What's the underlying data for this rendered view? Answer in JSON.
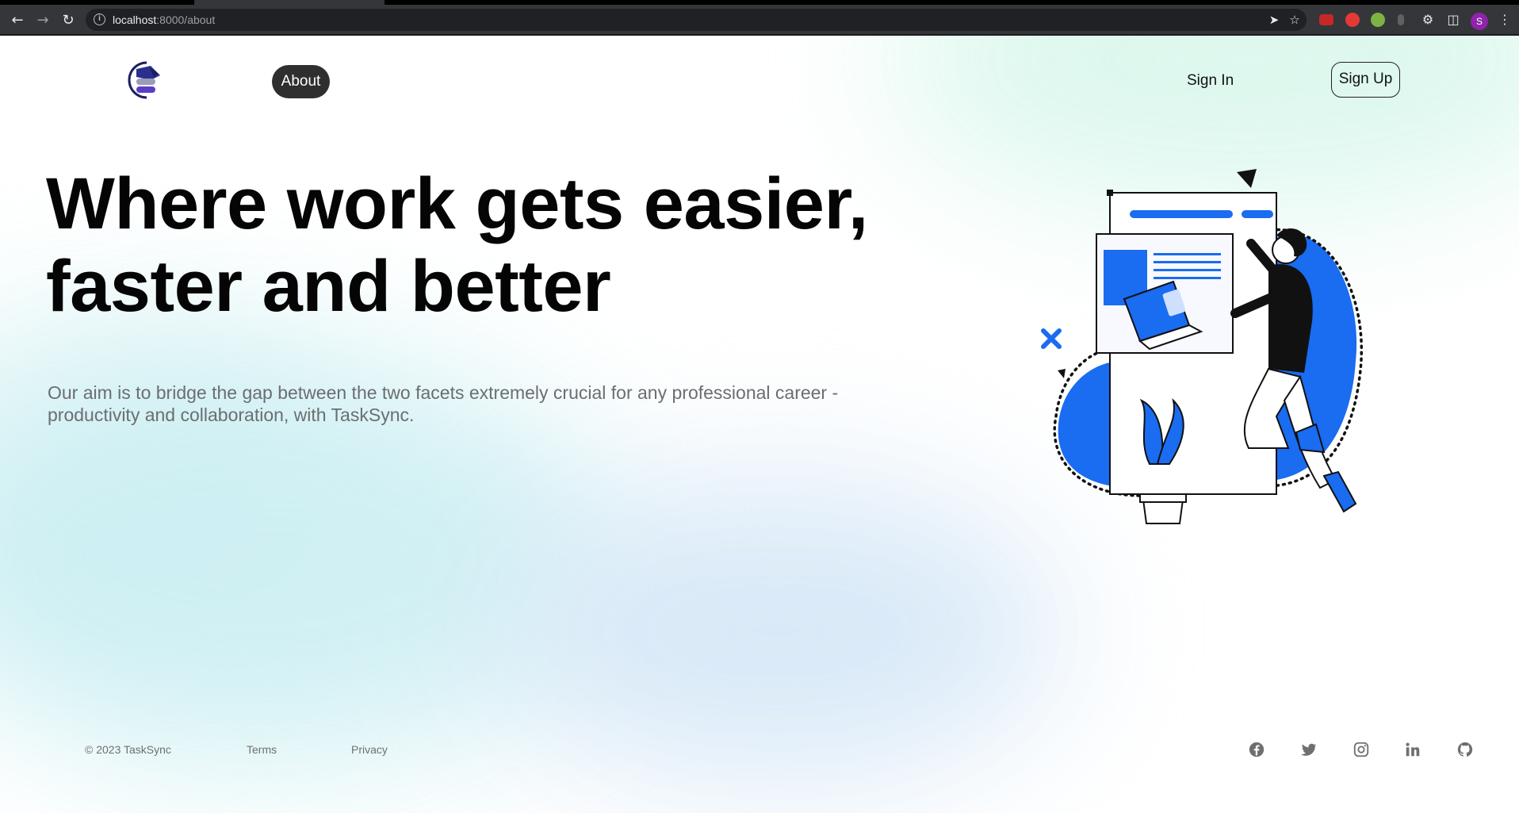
{
  "browser": {
    "url_host": "localhost",
    "url_path": ":8000/about",
    "profile_initial": "S",
    "icons": [
      "back-icon",
      "forward-icon",
      "reload-icon",
      "info-icon",
      "share-icon",
      "star-icon",
      "extensions-icon",
      "sidepanel-icon",
      "menu-icon"
    ]
  },
  "nav": {
    "about_label": "About",
    "signin_label": "Sign In",
    "signup_label": "Sign Up"
  },
  "hero": {
    "headline_line1": "Where work gets easier,",
    "headline_line2": "faster and better",
    "description_line1": "Our aim is to bridge the gap between the two facets extremely crucial for any professional career -",
    "description_line2": "productivity and collaboration, with TaskSync."
  },
  "footer": {
    "copyright": "© 2023 TaskSync",
    "terms_label": "Terms",
    "privacy_label": "Privacy",
    "social_icons": [
      "facebook-icon",
      "twitter-icon",
      "instagram-icon",
      "linkedin-icon",
      "github-icon"
    ]
  },
  "colors": {
    "accent_blue": "#1a6cf0",
    "dark_button": "#2f2f2f",
    "logo_purple": "#5a3ec8",
    "logo_navy": "#1c1f5c"
  }
}
